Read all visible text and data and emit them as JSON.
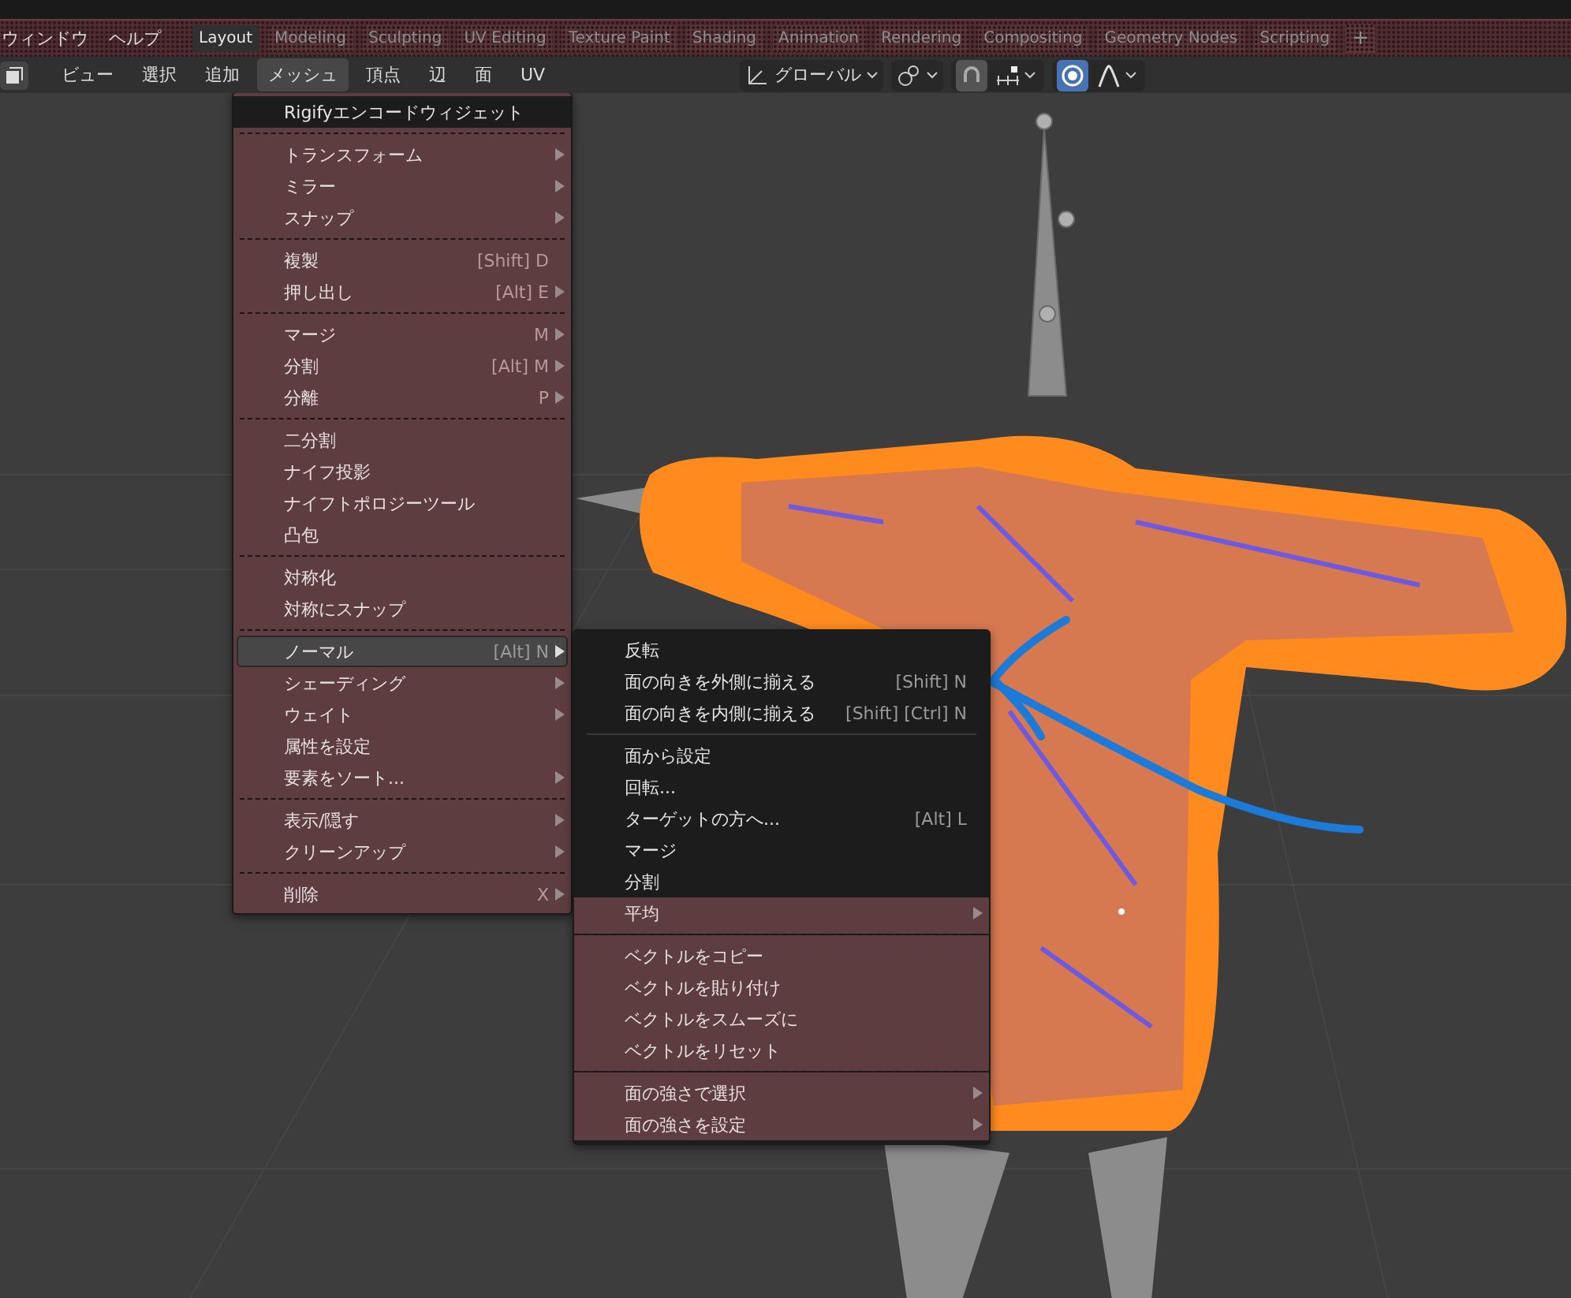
{
  "topbar": {
    "menus": [
      {
        "label": "ウィンドウ"
      },
      {
        "label": "ヘルプ"
      }
    ],
    "workspace_tabs": [
      {
        "label": "Layout",
        "selected": true
      },
      {
        "label": "Modeling",
        "selected": false
      },
      {
        "label": "Sculpting",
        "selected": false
      },
      {
        "label": "UV Editing",
        "selected": false
      },
      {
        "label": "Texture Paint",
        "selected": false
      },
      {
        "label": "Shading",
        "selected": false
      },
      {
        "label": "Animation",
        "selected": false
      },
      {
        "label": "Rendering",
        "selected": false
      },
      {
        "label": "Compositing",
        "selected": false
      },
      {
        "label": "Geometry Nodes",
        "selected": false
      },
      {
        "label": "Scripting",
        "selected": false
      }
    ],
    "add_tab": "+"
  },
  "header": {
    "menus": [
      {
        "label": "ビュー",
        "selected": false
      },
      {
        "label": "選択",
        "selected": false
      },
      {
        "label": "追加",
        "selected": false
      },
      {
        "label": "メッシュ",
        "selected": true
      },
      {
        "label": "頂点",
        "selected": false
      },
      {
        "label": "辺",
        "selected": false
      },
      {
        "label": "面",
        "selected": false
      },
      {
        "label": "UV",
        "selected": false
      }
    ],
    "orientation": "グローバル",
    "snapping_on": false,
    "proportional_on": true
  },
  "mesh_menu": {
    "items": [
      {
        "kind": "item",
        "label": "Rigifyエンコードウィジェット",
        "shaded": true,
        "selected": false,
        "submenu": false
      },
      {
        "kind": "separator",
        "shaded": false
      },
      {
        "kind": "item",
        "label": "トランスフォーム",
        "shaded": false,
        "selected": false,
        "submenu": true
      },
      {
        "kind": "item",
        "label": "ミラー",
        "shaded": false,
        "selected": false,
        "submenu": true
      },
      {
        "kind": "item",
        "label": "スナップ",
        "shaded": false,
        "selected": false,
        "submenu": true
      },
      {
        "kind": "separator",
        "shaded": false
      },
      {
        "kind": "item",
        "label": "複製",
        "shortcut": "[Shift] D",
        "shaded": false,
        "selected": false,
        "submenu": false
      },
      {
        "kind": "item",
        "label": "押し出し",
        "shortcut": "[Alt] E",
        "shaded": false,
        "selected": false,
        "submenu": true
      },
      {
        "kind": "separator",
        "shaded": false
      },
      {
        "kind": "item",
        "label": "マージ",
        "shortcut": "M",
        "shaded": false,
        "selected": false,
        "submenu": true
      },
      {
        "kind": "item",
        "label": "分割",
        "shortcut": "[Alt] M",
        "shaded": false,
        "selected": false,
        "submenu": true
      },
      {
        "kind": "item",
        "label": "分離",
        "shortcut": "P",
        "shaded": false,
        "selected": false,
        "submenu": true
      },
      {
        "kind": "separator",
        "shaded": false
      },
      {
        "kind": "item",
        "label": "二分割",
        "shaded": false,
        "selected": false,
        "submenu": false
      },
      {
        "kind": "item",
        "label": "ナイフ投影",
        "shaded": false,
        "selected": false,
        "submenu": false
      },
      {
        "kind": "item",
        "label": "ナイフトポロジーツール",
        "shaded": false,
        "selected": false,
        "submenu": false
      },
      {
        "kind": "item",
        "label": "凸包",
        "shaded": false,
        "selected": false,
        "submenu": false
      },
      {
        "kind": "separator",
        "shaded": false
      },
      {
        "kind": "item",
        "label": "対称化",
        "shaded": false,
        "selected": false,
        "submenu": false
      },
      {
        "kind": "item",
        "label": "対称にスナップ",
        "shaded": false,
        "selected": false,
        "submenu": false
      },
      {
        "kind": "separator",
        "shaded": false
      },
      {
        "kind": "item",
        "label": "ノーマル",
        "shortcut": "[Alt] N",
        "shaded": false,
        "selected": true,
        "submenu": true
      },
      {
        "kind": "item",
        "label": "シェーディング",
        "shaded": false,
        "selected": false,
        "submenu": true
      },
      {
        "kind": "item",
        "label": "ウェイト",
        "shaded": false,
        "selected": false,
        "submenu": true
      },
      {
        "kind": "item",
        "label": "属性を設定",
        "shaded": false,
        "selected": false,
        "submenu": false
      },
      {
        "kind": "item",
        "label": "要素をソート...",
        "shaded": false,
        "selected": false,
        "submenu": true
      },
      {
        "kind": "separator",
        "shaded": false
      },
      {
        "kind": "item",
        "label": "表示/隠す",
        "shaded": false,
        "selected": false,
        "submenu": true
      },
      {
        "kind": "item",
        "label": "クリーンアップ",
        "shaded": false,
        "selected": false,
        "submenu": true
      },
      {
        "kind": "separator",
        "shaded": false
      },
      {
        "kind": "item",
        "label": "削除",
        "shortcut": "X",
        "shaded": false,
        "selected": false,
        "submenu": true
      }
    ]
  },
  "normals_submenu": {
    "items": [
      {
        "kind": "item",
        "label": "反転",
        "shaded": true,
        "selected": false,
        "submenu": false
      },
      {
        "kind": "item",
        "label": "面の向きを外側に揃える",
        "shortcut": "[Shift] N",
        "shaded": true,
        "selected": false,
        "submenu": false
      },
      {
        "kind": "item",
        "label": "面の向きを内側に揃える",
        "shortcut": "[Shift] [Ctrl] N",
        "shaded": true,
        "selected": false,
        "submenu": false
      },
      {
        "kind": "separator",
        "shaded": true
      },
      {
        "kind": "item",
        "label": "面から設定",
        "shaded": true,
        "selected": false,
        "submenu": false
      },
      {
        "kind": "item",
        "label": "回転...",
        "shaded": true,
        "selected": false,
        "submenu": false
      },
      {
        "kind": "item",
        "label": "ターゲットの方へ...",
        "shortcut": "[Alt] L",
        "shaded": true,
        "selected": false,
        "submenu": false
      },
      {
        "kind": "item",
        "label": "マージ",
        "shaded": true,
        "selected": false,
        "submenu": false
      },
      {
        "kind": "item",
        "label": "分割",
        "shaded": true,
        "selected": false,
        "submenu": false
      },
      {
        "kind": "item",
        "label": "平均",
        "shaded": false,
        "selected": false,
        "submenu": true
      },
      {
        "kind": "separator",
        "shaded": false
      },
      {
        "kind": "item",
        "label": "ベクトルをコピー",
        "shaded": false,
        "selected": false,
        "submenu": false
      },
      {
        "kind": "item",
        "label": "ベクトルを貼り付け",
        "shaded": false,
        "selected": false,
        "submenu": false
      },
      {
        "kind": "item",
        "label": "ベクトルをスムーズに",
        "shaded": false,
        "selected": false,
        "submenu": false
      },
      {
        "kind": "item",
        "label": "ベクトルをリセット",
        "shaded": false,
        "selected": false,
        "submenu": false
      },
      {
        "kind": "separator",
        "shaded": false
      },
      {
        "kind": "item",
        "label": "面の強さで選択",
        "shaded": false,
        "selected": false,
        "submenu": true
      },
      {
        "kind": "item",
        "label": "面の強さを設定",
        "shaded": false,
        "selected": false,
        "submenu": true
      }
    ]
  }
}
